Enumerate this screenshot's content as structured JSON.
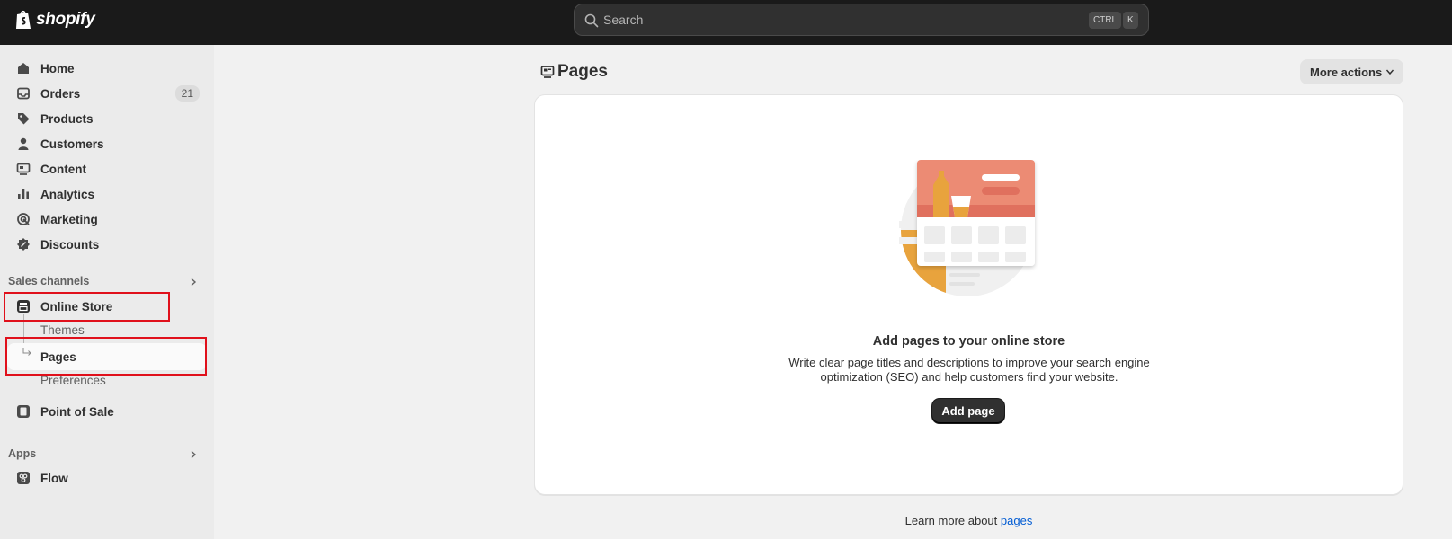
{
  "topbar": {
    "brand": "shopify",
    "search_placeholder": "Search",
    "shortcut_ctrl": "CTRL",
    "shortcut_k": "K"
  },
  "sidebar": {
    "items": [
      {
        "label": "Home",
        "icon": "home-icon"
      },
      {
        "label": "Orders",
        "icon": "inbox-icon",
        "badge": "21"
      },
      {
        "label": "Products",
        "icon": "tag-icon"
      },
      {
        "label": "Customers",
        "icon": "person-icon"
      },
      {
        "label": "Content",
        "icon": "content-icon"
      },
      {
        "label": "Analytics",
        "icon": "bar-chart-icon"
      },
      {
        "label": "Marketing",
        "icon": "target-icon"
      },
      {
        "label": "Discounts",
        "icon": "discount-icon"
      }
    ],
    "sales_channels_heading": "Sales channels",
    "online_store": "Online Store",
    "sub_items": {
      "themes": "Themes",
      "pages": "Pages",
      "preferences": "Preferences"
    },
    "point_of_sale": "Point of Sale",
    "apps_heading": "Apps",
    "flow": "Flow"
  },
  "main": {
    "title": "Pages",
    "more_actions": "More actions",
    "empty_state": {
      "title": "Add pages to your online store",
      "description": "Write clear page titles and descriptions to improve your search engine optimization (SEO) and help customers find your website.",
      "button": "Add page"
    },
    "learn_more_prefix": "Learn more about",
    "learn_more_link": "pages"
  },
  "colors": {
    "topbar": "#1a1a1a",
    "sidebar": "#ebebeb",
    "highlight_box": "#e0101b",
    "link": "#005bd3",
    "primary_button": "#303030"
  }
}
